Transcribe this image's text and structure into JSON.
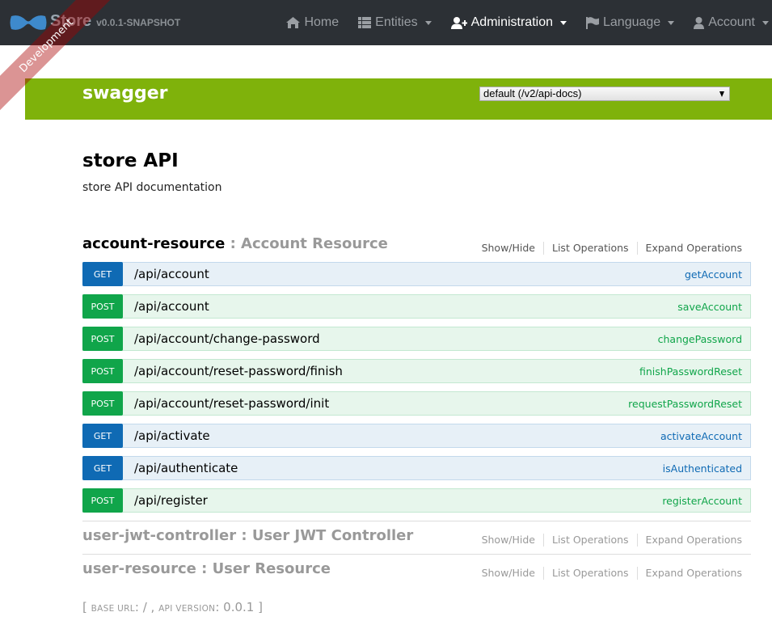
{
  "navbar": {
    "brand": "Store",
    "version": "v0.0.1-SNAPSHOT",
    "items": [
      {
        "label": "Home",
        "icon": "home-icon",
        "dropdown": false,
        "active": false
      },
      {
        "label": "Entities",
        "icon": "th-list-icon",
        "dropdown": true,
        "active": false
      },
      {
        "label": "Administration",
        "icon": "user-plus-icon",
        "dropdown": true,
        "active": true
      },
      {
        "label": "Language",
        "icon": "flag-icon",
        "dropdown": true,
        "active": false
      },
      {
        "label": "Account",
        "icon": "user-icon",
        "dropdown": true,
        "active": false
      }
    ]
  },
  "ribbon": {
    "label": "Development"
  },
  "swagger": {
    "logo": "swagger",
    "spec_select": {
      "selected": "default (/v2/api-docs)"
    }
  },
  "info": {
    "title": "store API",
    "description": "store API documentation"
  },
  "resources": [
    {
      "name": "account-resource",
      "separator": " : ",
      "description": "Account Resource",
      "expanded": true,
      "options": [
        "Show/Hide",
        "List Operations",
        "Expand Operations"
      ],
      "operations": [
        {
          "method": "GET",
          "path": "/api/account",
          "nickname": "getAccount"
        },
        {
          "method": "POST",
          "path": "/api/account",
          "nickname": "saveAccount"
        },
        {
          "method": "POST",
          "path": "/api/account/change-password",
          "nickname": "changePassword"
        },
        {
          "method": "POST",
          "path": "/api/account/reset-password/finish",
          "nickname": "finishPasswordReset"
        },
        {
          "method": "POST",
          "path": "/api/account/reset-password/init",
          "nickname": "requestPasswordReset"
        },
        {
          "method": "GET",
          "path": "/api/activate",
          "nickname": "activateAccount"
        },
        {
          "method": "GET",
          "path": "/api/authenticate",
          "nickname": "isAuthenticated"
        },
        {
          "method": "POST",
          "path": "/api/register",
          "nickname": "registerAccount"
        }
      ]
    },
    {
      "name": "user-jwt-controller",
      "separator": " : ",
      "description": "User JWT Controller",
      "expanded": false,
      "options": [
        "Show/Hide",
        "List Operations",
        "Expand Operations"
      ]
    },
    {
      "name": "user-resource",
      "separator": " : ",
      "description": "User Resource",
      "expanded": false,
      "options": [
        "Show/Hide",
        "List Operations",
        "Expand Operations"
      ]
    }
  ],
  "footer": {
    "open": "[ ",
    "base_url_label": "BASE URL",
    "base_url_value": ": / , ",
    "api_version_label": "API VERSION",
    "api_version_value": ": 0.0.1",
    "close": " ]"
  },
  "colors": {
    "navbar_bg": "#2c3035",
    "swagger_green": "#7fb20b",
    "get_method": "#0f6ab4",
    "post_method": "#10a54a",
    "get_row_bg": "#e7f0f7",
    "post_row_bg": "#e7f6ec"
  }
}
